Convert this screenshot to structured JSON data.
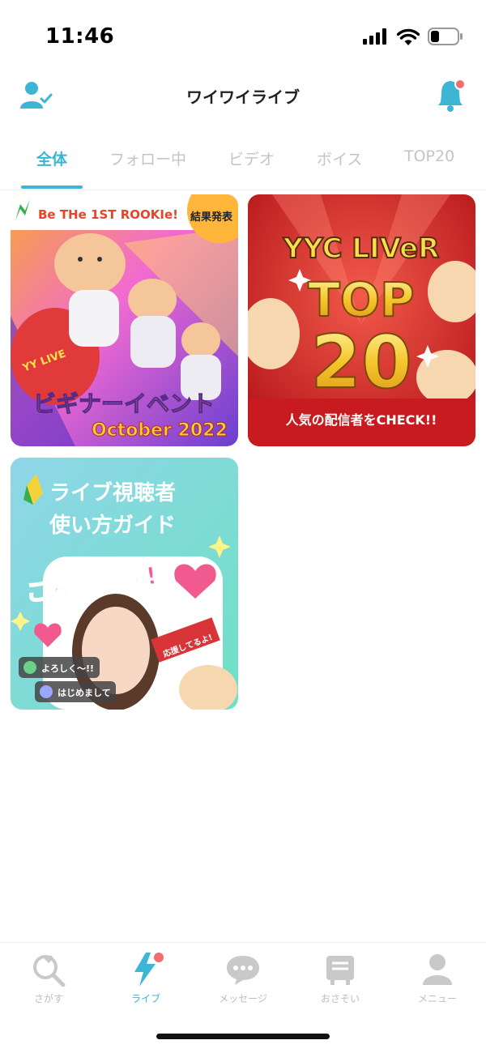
{
  "status_bar": {
    "time": "11:46"
  },
  "header": {
    "title": "ワイワイライブ"
  },
  "tabs": [
    {
      "label": "全体",
      "active": true
    },
    {
      "label": "フォロー中",
      "active": false
    },
    {
      "label": "ビデオ",
      "active": false
    },
    {
      "label": "ボイス",
      "active": false
    },
    {
      "label": "TOP20",
      "active": false
    }
  ],
  "cards": {
    "rookie": {
      "banner": "Be THe 1ST ROOKIe!",
      "badge": "結果発表",
      "brand": "YY LIVE",
      "title": "ビギナーイベント",
      "subtitle": "October 2022"
    },
    "top20": {
      "line1": "YYC LIVeR",
      "line2": "TOP",
      "line3": "20",
      "caption": "人気の配信者をCHECK!!"
    },
    "guide": {
      "title_line1": "ライブ視聴者",
      "title_line2": "使い方ガイド",
      "greeting": "こんちゃす!",
      "comment1": "よろしく〜!!",
      "comment2": "はじめまして",
      "flag": "応援してるよ!"
    }
  },
  "bottom_nav": [
    {
      "label": "さがす",
      "icon": "search-heart-icon",
      "active": false
    },
    {
      "label": "ライブ",
      "icon": "lightning-icon",
      "active": true
    },
    {
      "label": "メッセージ",
      "icon": "chat-bubble-icon",
      "active": false
    },
    {
      "label": "おさそい",
      "icon": "invite-list-icon",
      "active": false
    },
    {
      "label": "メニュー",
      "icon": "person-icon",
      "active": false
    }
  ],
  "colors": {
    "accent": "#3db5d4",
    "notification_dot": "#f26d6d",
    "inactive": "#c4c4c4"
  }
}
